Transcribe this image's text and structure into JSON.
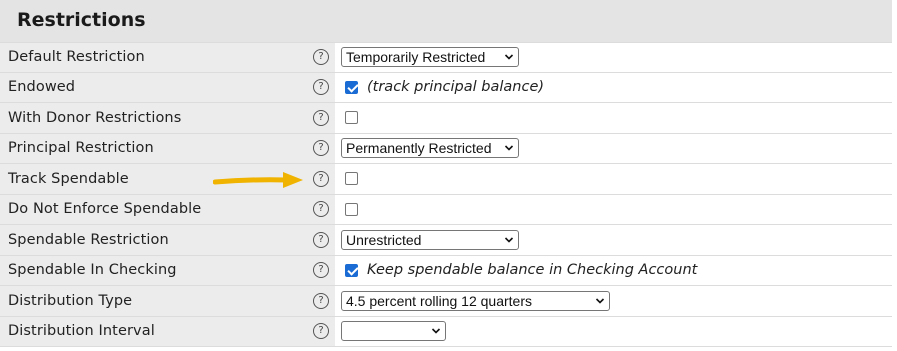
{
  "section": {
    "title": "Restrictions"
  },
  "fields": [
    {
      "label": "Default Restriction",
      "control": "select",
      "value": "Temporarily Restricted"
    },
    {
      "label": "Endowed",
      "control": "checkbox",
      "checked": true,
      "note": "(track principal balance)"
    },
    {
      "label": "With Donor Restrictions",
      "control": "checkbox",
      "checked": false
    },
    {
      "label": "Principal Restriction",
      "control": "select",
      "value": "Permanently Restricted"
    },
    {
      "label": "Track Spendable",
      "control": "checkbox",
      "checked": false
    },
    {
      "label": "Do Not Enforce Spendable",
      "control": "checkbox",
      "checked": false
    },
    {
      "label": "Spendable Restriction",
      "control": "select",
      "value": "Unrestricted"
    },
    {
      "label": "Spendable In Checking",
      "control": "checkbox",
      "checked": true,
      "note": "Keep spendable balance in Checking Account"
    },
    {
      "label": "Distribution Type",
      "control": "select",
      "value": "4.5 percent rolling 12 quarters"
    },
    {
      "label": "Distribution Interval",
      "control": "select",
      "value": ""
    }
  ],
  "help_icon": "question-circle-icon",
  "annotation": {
    "icon": "arrow-right-icon",
    "color": "#f0b400"
  },
  "colors": {
    "header_bg": "#e4e4e4",
    "label_bg": "#ececec",
    "checkbox_checked": "#1a6cd4"
  }
}
